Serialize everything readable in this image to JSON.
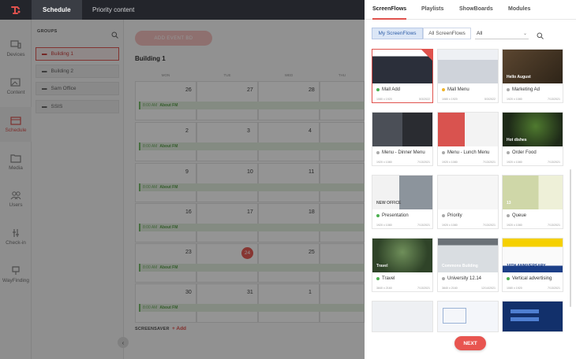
{
  "topbar": {
    "tabs": [
      {
        "label": "Schedule"
      },
      {
        "label": "Priority content"
      }
    ]
  },
  "sidebar": {
    "items": [
      {
        "label": "Devices",
        "icon": "devices-icon"
      },
      {
        "label": "Content",
        "icon": "content-icon"
      },
      {
        "label": "Schedule",
        "icon": "schedule-icon"
      },
      {
        "label": "Media",
        "icon": "media-icon"
      },
      {
        "label": "Users",
        "icon": "users-icon"
      },
      {
        "label": "Check-in",
        "icon": "checkin-icon"
      },
      {
        "label": "WayFinding",
        "icon": "wayfinding-icon"
      }
    ]
  },
  "groups": {
    "title": "GROUPS",
    "items": [
      {
        "label": "Building 1"
      },
      {
        "label": "Building 2"
      },
      {
        "label": "Sam Office"
      },
      {
        "label": "SSIS"
      }
    ]
  },
  "calendar": {
    "add_event": "ADD EVENT BD",
    "title": "Building 1",
    "days": [
      "MON",
      "TUE",
      "WED",
      "THU"
    ],
    "weeks": [
      [
        "26",
        "27",
        "28",
        ""
      ],
      [
        "2",
        "3",
        "4",
        ""
      ],
      [
        "9",
        "10",
        "11",
        ""
      ],
      [
        "16",
        "17",
        "18",
        ""
      ],
      [
        "23",
        "24",
        "25",
        ""
      ],
      [
        "30",
        "31",
        "1",
        ""
      ]
    ],
    "today": "24",
    "event_time": "8:00 AM",
    "event_name": "About FM",
    "screensaver": "SCREENSAVER",
    "add": "Add"
  },
  "panel": {
    "tabs": [
      {
        "label": "ScreenFlows"
      },
      {
        "label": "Playlists"
      },
      {
        "label": "ShowBoards"
      },
      {
        "label": "Modules"
      }
    ],
    "seg_mine": "My ScreenFlows",
    "seg_all": "All ScreenFlows",
    "filter": "All",
    "next": "NEXT",
    "cards": [
      {
        "name": "Mall Add",
        "status": "#4cb050",
        "dims": "1080 x 1920",
        "date": "5/3/2022",
        "selected": true
      },
      {
        "name": "Mall Menu",
        "status": "#f0b429",
        "dims": "1080 x 1920",
        "date": "5/3/2022"
      },
      {
        "name": "Marketing Ad",
        "status": "#aaaaaa",
        "dims": "1920 x 1080",
        "date": "7/13/2021",
        "thumb_text": "Hello August"
      },
      {
        "name": "Menu - Dinner Menu",
        "status": "#aaaaaa",
        "dims": "1920 x 1080",
        "date": "7/13/2021"
      },
      {
        "name": "Menu - Lunch Menu",
        "status": "#aaaaaa",
        "dims": "1920 x 1080",
        "date": "7/13/2021"
      },
      {
        "name": "Order Food",
        "status": "#aaaaaa",
        "dims": "1920 x 1080",
        "date": "7/13/2021",
        "thumb_text": "Hot dishes"
      },
      {
        "name": "Presentation",
        "status": "#4cb050",
        "dims": "1920 x 1080",
        "date": "7/13/2021",
        "thumb_text": "NEW OFFICE"
      },
      {
        "name": "Priority",
        "status": "#aaaaaa",
        "dims": "1920 x 1080",
        "date": "7/13/2021"
      },
      {
        "name": "Queue",
        "status": "#aaaaaa",
        "dims": "1920 x 1080",
        "date": "7/13/2021",
        "thumb_text": "13"
      },
      {
        "name": "Travel",
        "status": "#4cb050",
        "dims": "3840 x 2160",
        "date": "7/13/2021",
        "thumb_text": "Travel"
      },
      {
        "name": "University 12.14",
        "status": "#aaaaaa",
        "dims": "3840 x 2160",
        "date": "12/14/2021",
        "thumb_text": "Commons Building"
      },
      {
        "name": "Vertical advertising",
        "status": "#4cb050",
        "dims": "1080 x 1920",
        "date": "7/13/2021",
        "thumb_text": "10TH ANNIVERSARY"
      }
    ]
  }
}
